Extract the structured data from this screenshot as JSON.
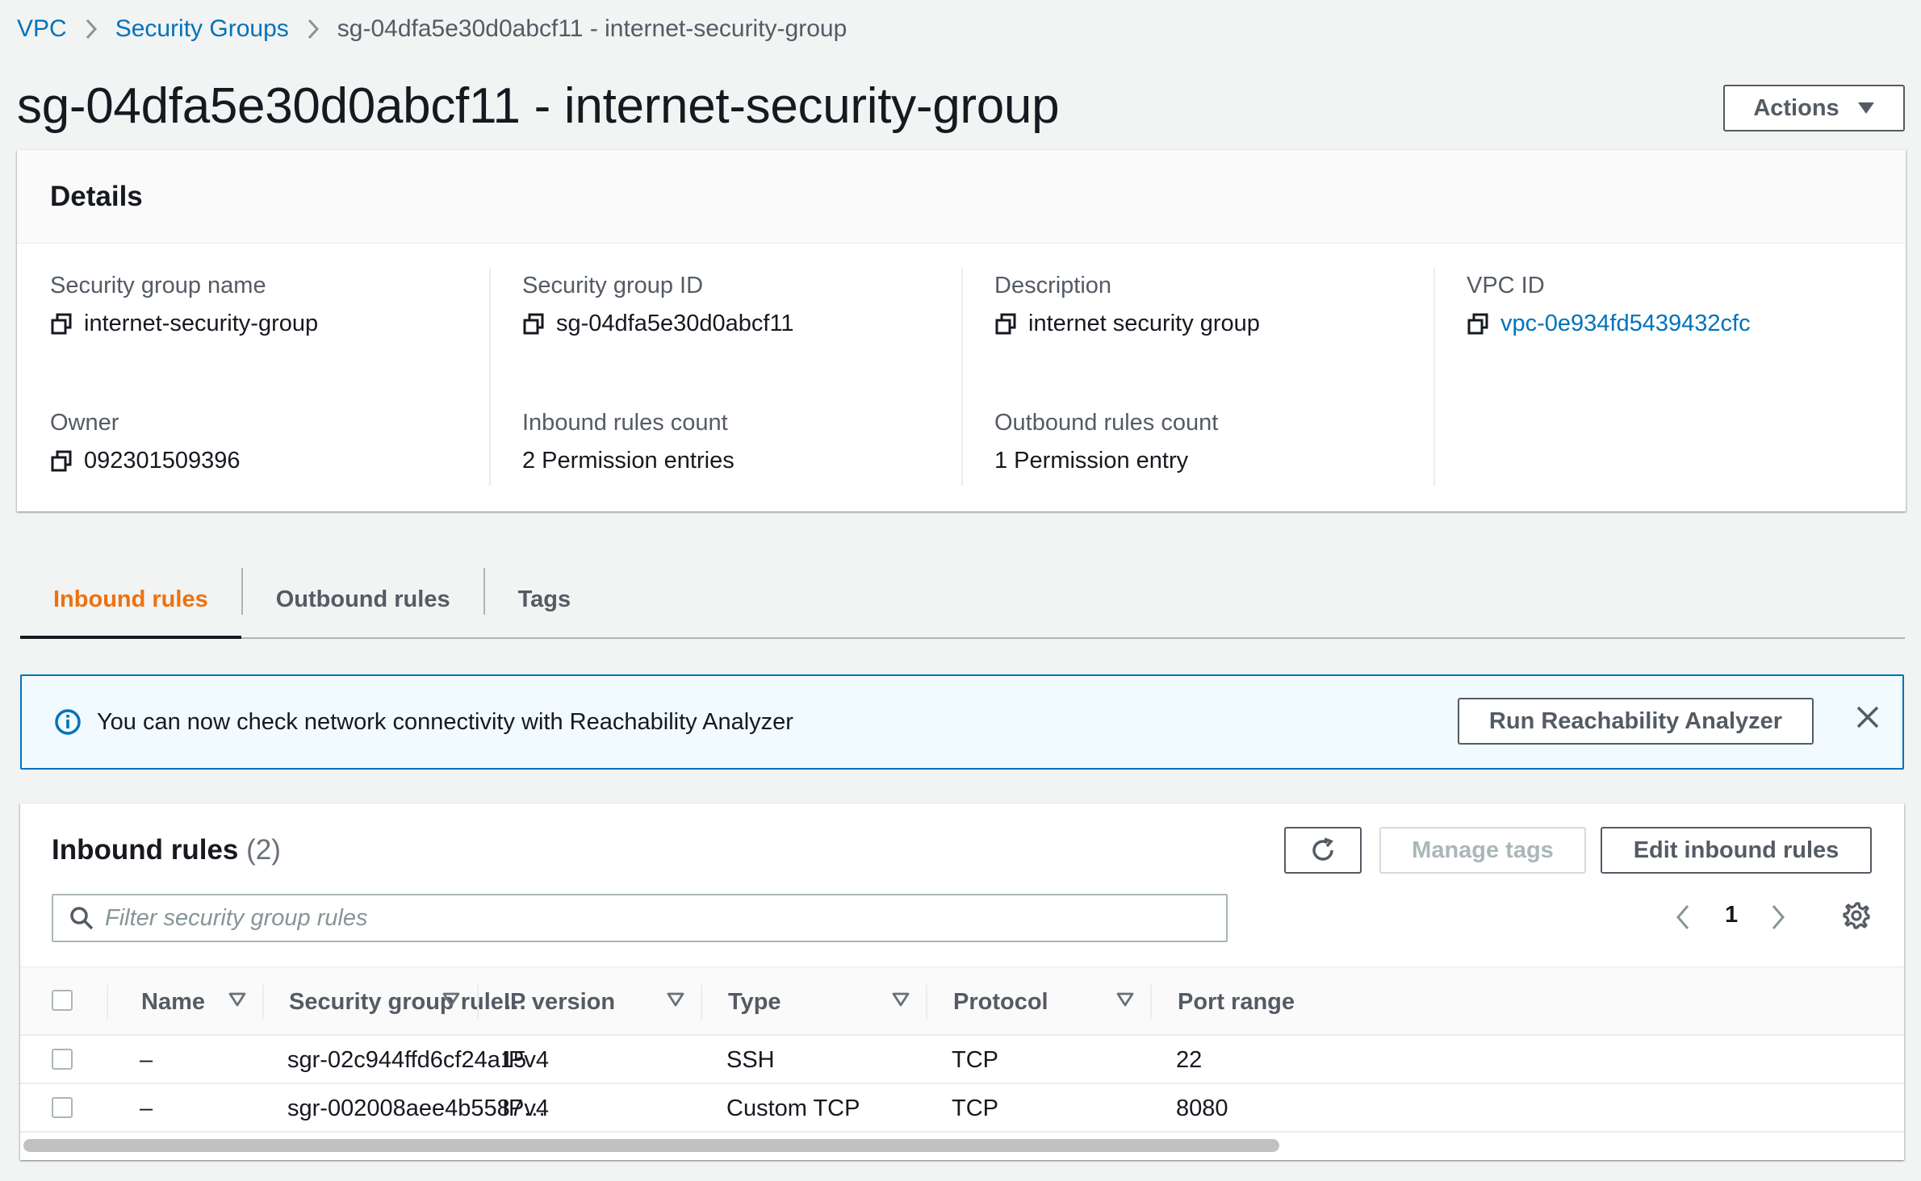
{
  "breadcrumb": {
    "vpc": "VPC",
    "security_groups": "Security Groups",
    "current": "sg-04dfa5e30d0abcf11 - internet-security-group"
  },
  "page_title": "sg-04dfa5e30d0abcf11 - internet-security-group",
  "actions_label": "Actions",
  "details": {
    "title": "Details",
    "security_group_name": {
      "label": "Security group name",
      "value": "internet-security-group"
    },
    "security_group_id": {
      "label": "Security group ID",
      "value": "sg-04dfa5e30d0abcf11"
    },
    "description": {
      "label": "Description",
      "value": "internet security group"
    },
    "vpc_id": {
      "label": "VPC ID",
      "value": "vpc-0e934fd5439432cfc"
    },
    "owner": {
      "label": "Owner",
      "value": "092301509396"
    },
    "inbound_rules_count": {
      "label": "Inbound rules count",
      "value": "2 Permission entries"
    },
    "outbound_rules_count": {
      "label": "Outbound rules count",
      "value": "1 Permission entry"
    }
  },
  "tabs": [
    {
      "label": "Inbound rules",
      "active": true
    },
    {
      "label": "Outbound rules",
      "active": false
    },
    {
      "label": "Tags",
      "active": false
    }
  ],
  "banner": {
    "text": "You can now check network connectivity with Reachability Analyzer",
    "button_label": "Run Reachability Analyzer"
  },
  "rules_panel": {
    "title": "Inbound rules",
    "count": "(2)",
    "manage_tags_label": "Manage tags",
    "edit_label": "Edit inbound rules",
    "filter_placeholder": "Filter security group rules",
    "page_number": "1",
    "columns": [
      "Name",
      "Security group rule…",
      "IP version",
      "Type",
      "Protocol",
      "Port range"
    ],
    "rows": [
      {
        "name": "–",
        "rule_id": "sgr-02c944ffd6cf24a15",
        "ip_version": "IPv4",
        "type": "SSH",
        "protocol": "TCP",
        "port_range": "22"
      },
      {
        "name": "–",
        "rule_id": "sgr-002008aee4b5587…",
        "ip_version": "IPv4",
        "type": "Custom TCP",
        "protocol": "TCP",
        "port_range": "8080"
      }
    ]
  },
  "colors": {
    "link": "#0073bb",
    "active_tab": "#ec7211",
    "banner_bg": "#f1faff",
    "banner_border": "#0073bb",
    "text": "#16191f",
    "muted": "#545b64"
  },
  "icons": [
    "chevron-right-icon",
    "caret-down-icon",
    "copy-icon",
    "info-icon",
    "close-icon",
    "refresh-icon",
    "search-icon",
    "chevron-left-icon",
    "gear-icon",
    "sort-caret-icon",
    "checkbox"
  ]
}
